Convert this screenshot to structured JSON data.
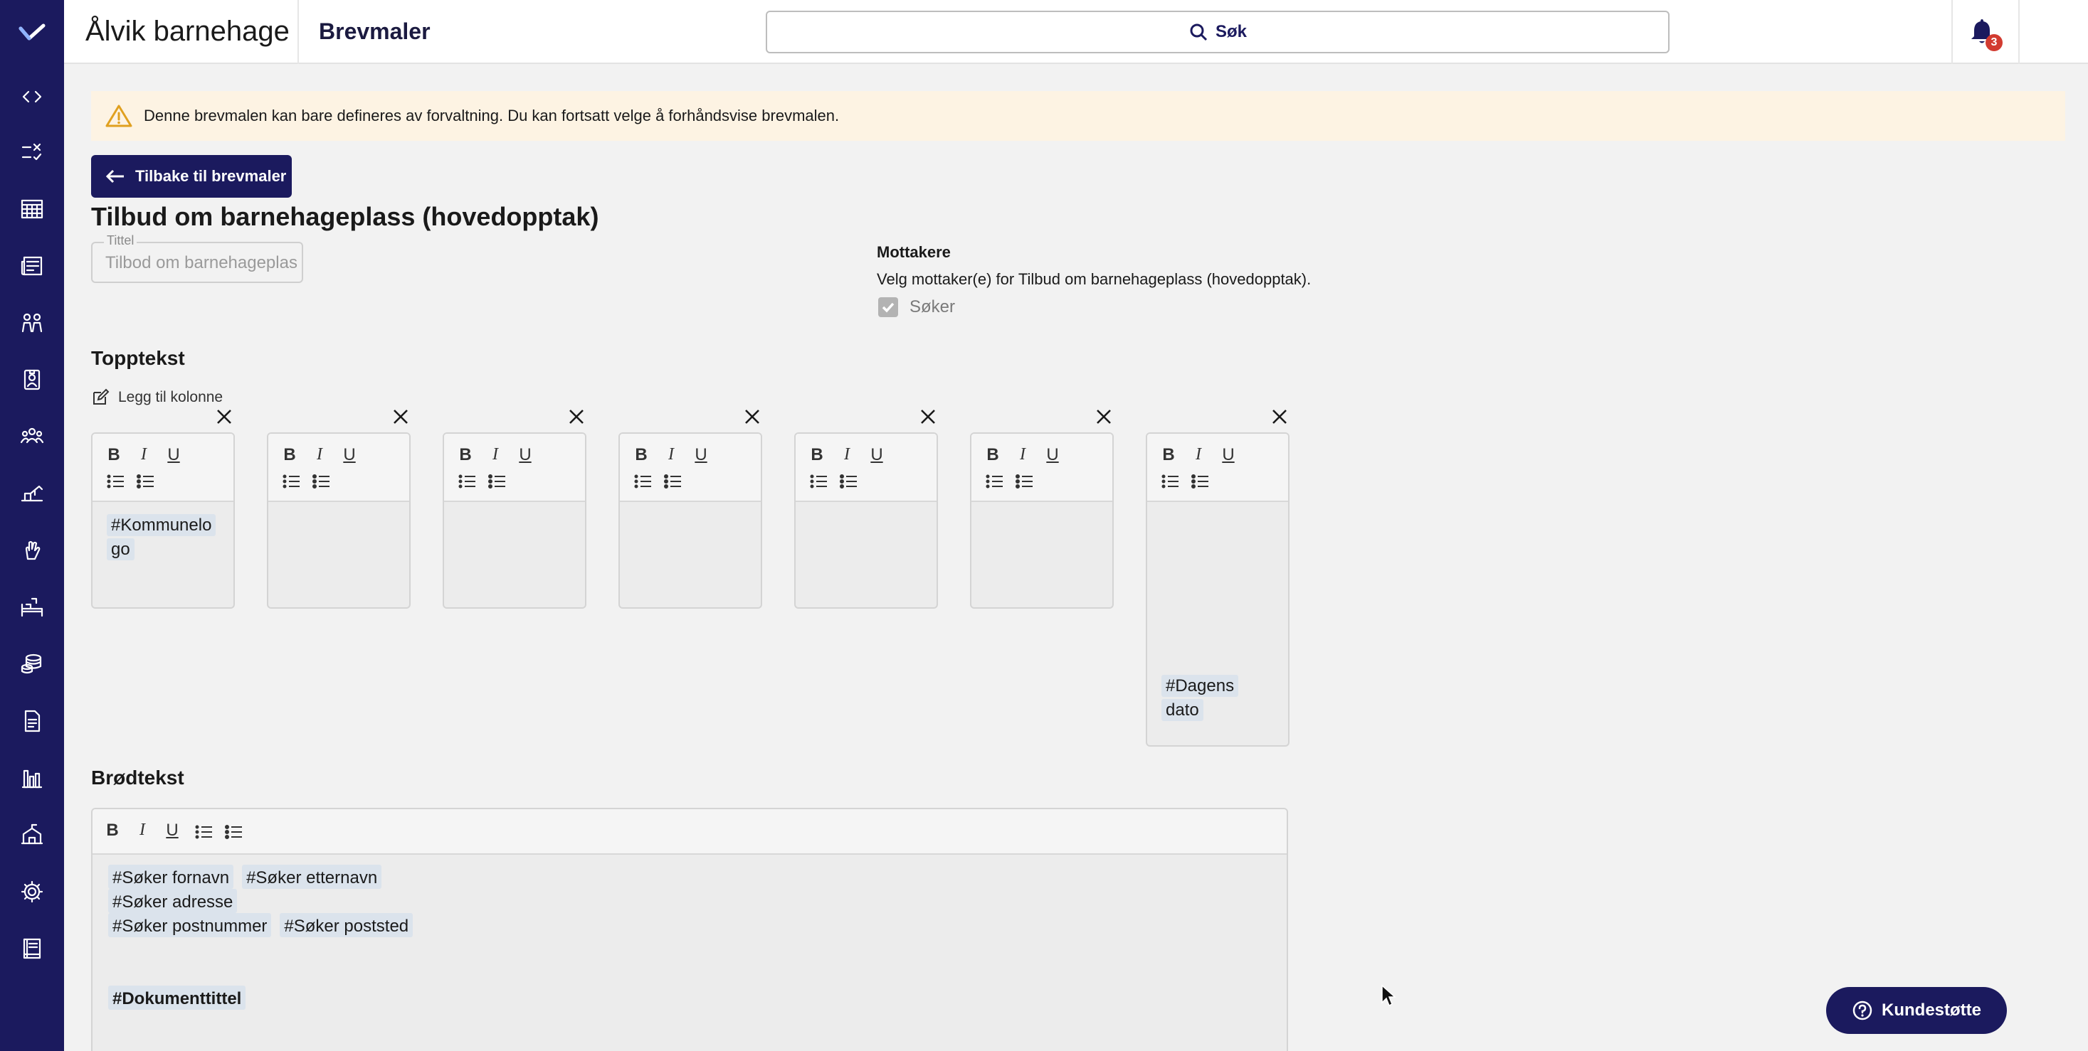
{
  "header": {
    "app_name": "Ålvik barnehage",
    "page": "Brevmaler",
    "search_label": "Søk",
    "notification_count": "3"
  },
  "rail": {
    "icons": [
      "logo-icon",
      "code-icon",
      "tasks-icon",
      "calendar-grid-icon",
      "newspaper-icon",
      "children-icon",
      "badge-icon",
      "group-icon",
      "playground-icon",
      "hand-icon",
      "bed-icon",
      "coins-icon",
      "document-icon",
      "bar-chart-icon",
      "school-icon",
      "gear-icon",
      "book-icon"
    ]
  },
  "alert": {
    "text": "Denne brevmalen kan bare defineres av forvaltning. Du kan fortsatt velge å forhåndsvise brevmalen."
  },
  "back_button": "Tilbake til brevmaler",
  "document_title": "Tilbud om barnehageplass (hovedopptak)",
  "title_field": {
    "legend": "Tittel",
    "value": "Tilbod om barnehageplass"
  },
  "recipients": {
    "heading": "Mottakere",
    "description": "Velg mottaker(e) for Tilbud om barnehageplass (hovedopptak).",
    "options": [
      {
        "label": "Søker",
        "checked": true
      }
    ]
  },
  "header_section": {
    "heading": "Topptekst",
    "add_column": "Legg til kolonne",
    "columns": [
      {
        "tags": [
          "#Kommunelogo"
        ],
        "tag_lines": [
          "#Kommunelo",
          "go"
        ]
      },
      {
        "tags": []
      },
      {
        "tags": []
      },
      {
        "tags": []
      },
      {
        "tags": []
      },
      {
        "tags": []
      },
      {
        "tags": [
          "#Dagens dato"
        ],
        "tag_lines": [
          "#Dagens",
          "dato"
        ]
      }
    ]
  },
  "toolbar": {
    "bold": "B",
    "italic": "I",
    "underline": "U"
  },
  "body_section": {
    "heading": "Brødtekst",
    "lines": [
      [
        "#Søker fornavn",
        "#Søker etternavn"
      ],
      [
        "#Søker adresse"
      ],
      [
        "#Søker postnummer",
        "#Søker poststed"
      ]
    ],
    "title_tag": "#Dokumenttittel"
  },
  "support_button": "Kundestøtte",
  "colors": {
    "brand": "#1b1a5e",
    "alert_bg": "#fdf3e3",
    "badge": "#d23b30"
  }
}
